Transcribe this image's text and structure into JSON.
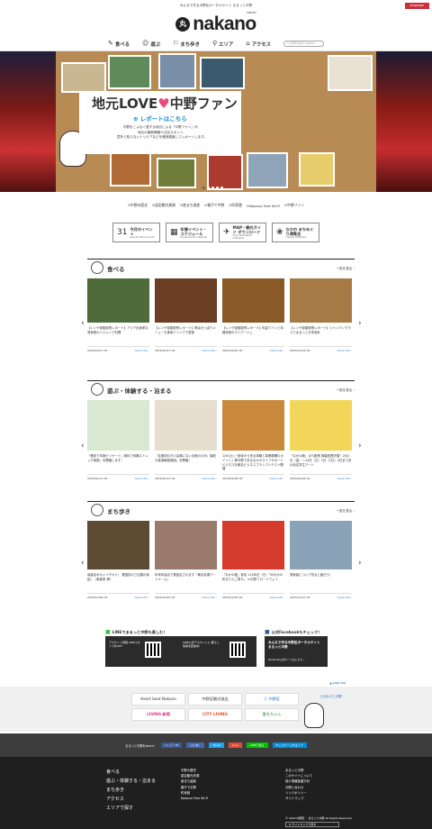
{
  "topbar": {
    "tagline": "みんなで作る中野区ポータルサイト まるっと中野",
    "lang": "language"
  },
  "logo": {
    "mark": "丸",
    "word": "nakano",
    "sub": "marutto"
  },
  "nav": {
    "items": [
      {
        "icon": "✎",
        "label": "食べる"
      },
      {
        "icon": "☺",
        "label": "遊ぶ"
      },
      {
        "icon": "⚐",
        "label": "まち歩き"
      },
      {
        "icon": "⚲",
        "label": "エリア"
      },
      {
        "icon": "⌂",
        "label": "アクセス"
      }
    ],
    "search_placeholder": "Q 記事を探す search"
  },
  "hero": {
    "title_a": "地元LOVE",
    "heart": "♥",
    "title_b": "中野ファン",
    "report": "⊕ レポートはこちら",
    "desc_1": "中野をこよなく愛する地元による「中野ファン」が、",
    "desc_2": "地元の最新情報や注目スポット、",
    "desc_3": "意外と知らないトリビアなどを徹底調査してレポートします。"
  },
  "sublinks": [
    "⊙中野の歴史",
    "⊙認定観光資源",
    "⊙産まち遺産",
    "⊙親子で中野",
    "⊙町家館",
    "⊙Nakano Free Wi-Fi",
    "⊙中野ファン"
  ],
  "features": [
    {
      "icon": "31",
      "title": "今月のイベント",
      "sub": "events of this month"
    },
    {
      "icon": "▦",
      "title": "年間イベント・スケジュール",
      "sub": "annual event schedule"
    },
    {
      "icon": "✈",
      "title": "MAP・観光ガイド ダウンロード",
      "sub": "map information download"
    },
    {
      "icon": "❀",
      "title": "なかの まちめぐり博覧会",
      "sub": "nakano exhibition"
    }
  ],
  "sections": [
    {
      "title": "食べる",
      "sub": "eat",
      "more": "一覧を見る ›",
      "cards": [
        {
          "text": "【レンゲ部副部長レポート】アジア出身家な昔家庭のバジェン丁料理",
          "date": "2015/12/27 UP",
          "more": "more info ›"
        },
        {
          "text": "【レンゲ部副部長レポート】節は元っぽりメニューも食後ドリンクで愛食",
          "date": "2015/12/27 UP",
          "more": "more info ›"
        },
        {
          "text": "【レンゲ部副部長レポート】料金ワインと本格和食のマリアージュ",
          "date": "2015/12/22 UP",
          "more": "more info ›"
        },
        {
          "text": "【レンゲ部副部長レポート】シャンパングラスでまるっと日本酒を",
          "date": "2015/12/19 UP",
          "more": "more info ›"
        }
      ]
    },
    {
      "title": "遊ぶ・体験する・泊まる",
      "sub": "play",
      "more": "一覧を見る ›",
      "cards": [
        {
          "text": "『格安で本格ビリヤード』無料で体験ストレッチ講座」を開催します！",
          "date": "2016/01/11 UP",
          "more": "more info ›"
        },
        {
          "text": "『支援割引き人会場にない合宿のため』講座も実演練習講座」を開催！",
          "date": "2016/01/11 UP",
          "more": "more info ›"
        },
        {
          "text": "1/30(土)「身体から来る体験と事業展開のポイント」等中野であるなかのライフサポートビジネスを頼るビジネスプランコンテスト開催",
          "date": "2016/01/08 UP",
          "more": "more info ›"
        },
        {
          "text": "『なかの蔵』まち散策 降臨型歴史展！2月1日（金）〜14日（日）2日（2日）4日まで多の品名学生アート",
          "date": "2016/01/08 UP",
          "more": "more info ›"
        }
      ]
    },
    {
      "title": "まち歩き",
      "sub": "walk",
      "more": "一覧を見る ›",
      "cards": [
        {
          "text": "高画店みたいイチオシ！ 要因抜かさ店展示後起！（美食家 帰）",
          "date": "2015/12/29 UP",
          "more": "more info ›"
        },
        {
          "text": "年末年始店で発送店されます「東京会場アートルーム」",
          "date": "2015/12/22 UP",
          "more": "more info ›"
        },
        {
          "text": "『なかの蔵』参加 11月8日（日）「みなかの町なりんご祭り」 in中野フロードウェイ",
          "date": "2015/11/05 UP",
          "more": "more info ›"
        },
        {
          "text": "清家製について知ると面白う！",
          "date": "2015/11/27 UP",
          "more": "more info ›"
        }
      ]
    }
  ],
  "sns": {
    "line_title": "LINEでまるっと中野も楽しむ！",
    "line_a": "アカウント登録 LINEスタンプをGET",
    "line_b": "LINE公式アカウントに 暮らし情報を配信中！",
    "fb_title": "公式Facebookもチェック！",
    "fb_text": "みんなで作る中野区ポータルサイト まるっと中野",
    "fb_sub": "Facebook公式ページはこちら ›"
  },
  "pagetop": "▲ page top",
  "banners": [
    {
      "text": "Heart beat Nakano"
    },
    {
      "text": "中野区観光協会"
    },
    {
      "text": "ⓝ 中野区"
    },
    {
      "text": "LIVING 新宿"
    },
    {
      "text": "CITY LIVING"
    },
    {
      "text": "番丸ちゃん"
    }
  ],
  "mascot_bubble": "ひまわりと中野",
  "share": {
    "label": "まるっと中野をshare！",
    "buttons": [
      "f シェア 28",
      "いいね！",
      "Tweet",
      "G+1",
      "LINEで送る",
      "B!このページをはてブ"
    ]
  },
  "footer": {
    "c1": [
      "食べる",
      "遊ぶ・体験する・泊まる",
      "まち歩き",
      "アクセス",
      "エリアで探す"
    ],
    "c2": [
      "中野の歴史",
      "認定観光資源",
      "産まち遺産",
      "親子で中野",
      "町家館",
      "Nakano Free Wi-Fi"
    ],
    "c3": [
      "まるっと中野",
      "このサイトについて",
      "個人情報保護方針",
      "お問い合わせ",
      "リンクポリシー",
      "サイトマップ"
    ],
    "copy": "© 2016 中野区 ・まるっと中野 All Rights Reserved.",
    "pm": "Q サイトマップで探す"
  },
  "colors": {
    "accent": "#c8313a",
    "link": "#1b6ec2",
    "footer": "#1f1f1f",
    "share": "#3d3d3d"
  }
}
